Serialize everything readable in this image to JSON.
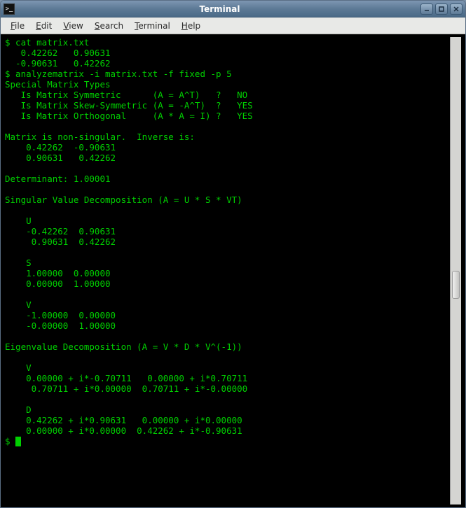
{
  "window": {
    "title": "Terminal",
    "icon_glyph": ">_"
  },
  "menu": {
    "file": "File",
    "edit": "Edit",
    "view": "View",
    "search": "Search",
    "terminal": "Terminal",
    "help": "Help"
  },
  "terminal": {
    "lines": [
      "$ cat matrix.txt",
      "   0.42262   0.90631",
      "  -0.90631   0.42262",
      "$ analyzematrix -i matrix.txt -f fixed -p 5",
      "Special Matrix Types",
      "   Is Matrix Symmetric      (A = A^T)   ?   NO",
      "   Is Matrix Skew-Symmetric (A = -A^T)  ?   YES",
      "   Is Matrix Orthogonal     (A * A = I) ?   YES",
      "",
      "Matrix is non-singular.  Inverse is:",
      "    0.42262  -0.90631",
      "    0.90631   0.42262",
      "",
      "Determinant: 1.00001",
      "",
      "Singular Value Decomposition (A = U * S * VT)",
      "",
      "    U",
      "    -0.42262  0.90631",
      "     0.90631  0.42262",
      "",
      "    S",
      "    1.00000  0.00000",
      "    0.00000  1.00000",
      "",
      "    V",
      "    -1.00000  0.00000",
      "    -0.00000  1.00000",
      "",
      "Eigenvalue Decomposition (A = V * D * V^(-1))",
      "",
      "    V",
      "    0.00000 + i*-0.70711   0.00000 + i*0.70711",
      "     0.70711 + i*0.00000  0.70711 + i*-0.00000",
      "",
      "    D",
      "    0.42262 + i*0.90631   0.00000 + i*0.00000",
      "    0.00000 + i*0.00000  0.42262 + i*-0.90631"
    ],
    "prompt": "$ "
  }
}
